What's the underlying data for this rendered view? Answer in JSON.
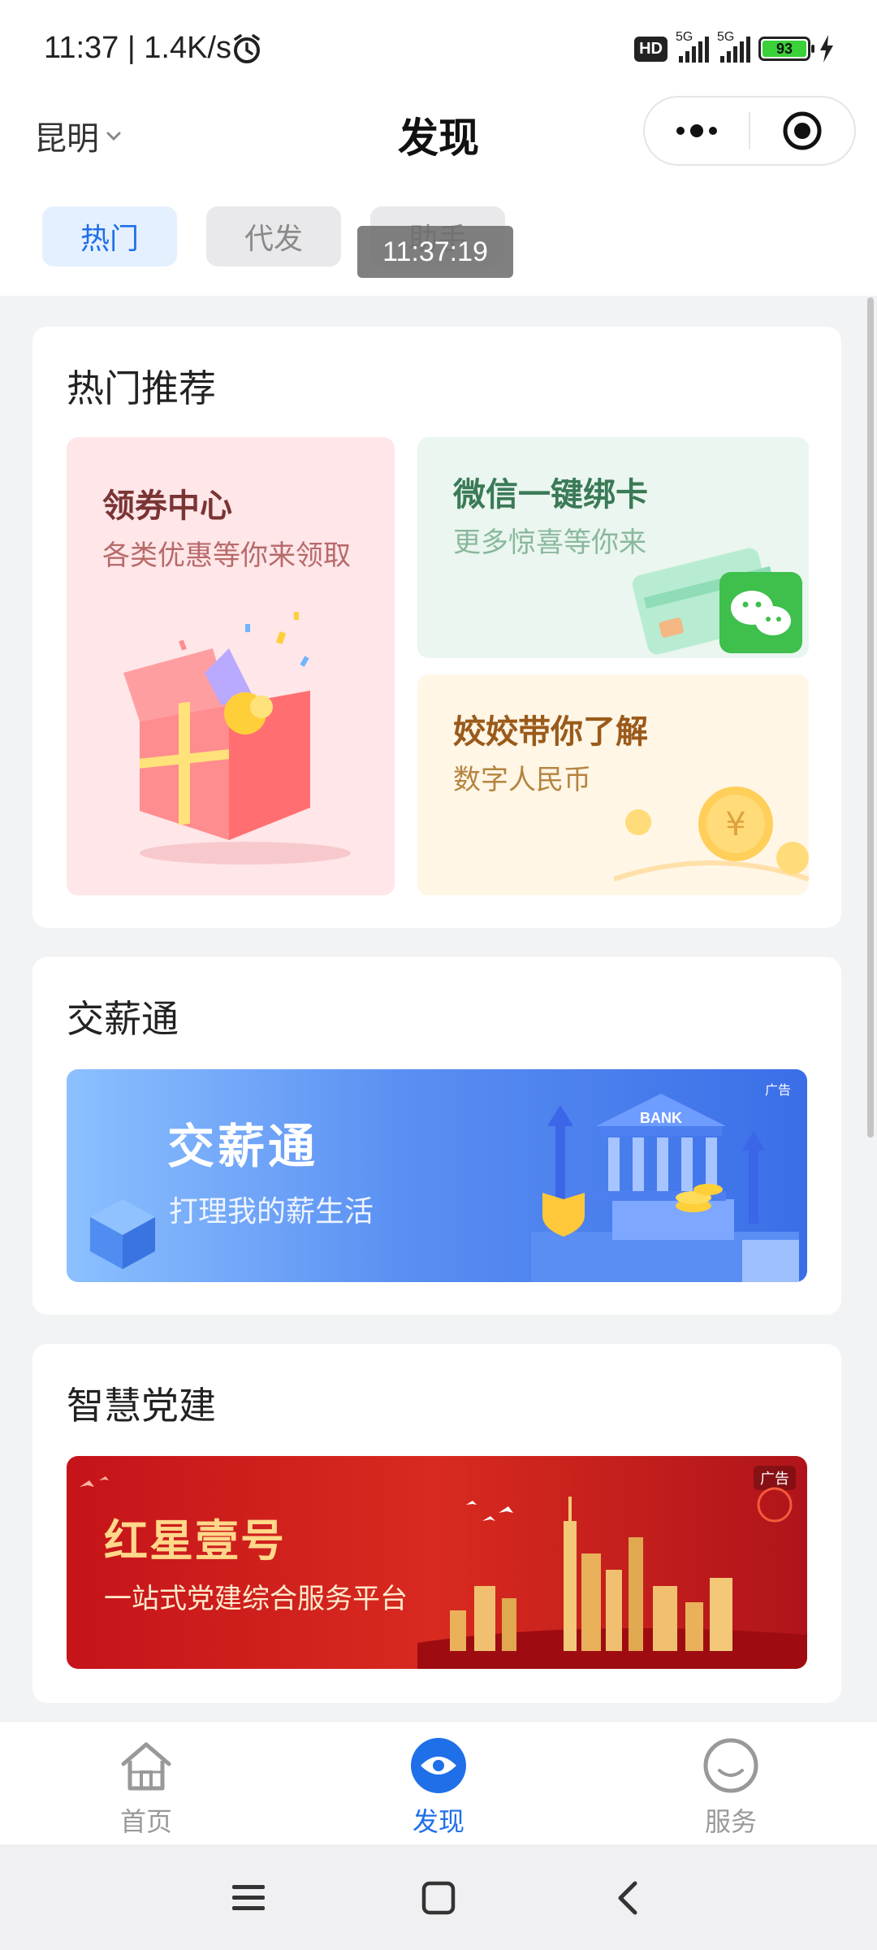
{
  "status_bar": {
    "time_speed": "11:37 | 1.4K/s",
    "hd_label": "HD",
    "signal1_label": "5G",
    "signal2_label": "5G",
    "battery_level": "93"
  },
  "header": {
    "city": "昆明",
    "title": "发现"
  },
  "tabs": [
    {
      "label": "热门",
      "active": true
    },
    {
      "label": "代发",
      "active": false
    },
    {
      "label": "助手",
      "active": false
    }
  ],
  "toast_time": "11:37:19",
  "hot": {
    "title": "热门推荐",
    "coupon": {
      "title": "领券中心",
      "subtitle": "各类优惠等你来领取"
    },
    "wechat": {
      "title": "微信一键绑卡",
      "subtitle": "更多惊喜等你来"
    },
    "rmb": {
      "title": "姣姣带你了解",
      "subtitle": "数字人民币"
    }
  },
  "salary": {
    "title": "交薪通",
    "banner_title": "交薪通",
    "banner_subtitle": "打理我的薪生活",
    "bank_text": "BANK",
    "ad_label": "广告"
  },
  "party": {
    "title": "智慧党建",
    "banner_title": "红星壹号",
    "banner_subtitle": "一站式党建综合服务平台",
    "ad_label": "广告"
  },
  "bottom_nav": [
    {
      "label": "首页",
      "icon": "home-icon",
      "active": false
    },
    {
      "label": "发现",
      "icon": "eye-icon",
      "active": true
    },
    {
      "label": "服务",
      "icon": "smile-icon",
      "active": false
    }
  ],
  "colors": {
    "accent": "#1f6fe8",
    "inactive": "#999999"
  }
}
